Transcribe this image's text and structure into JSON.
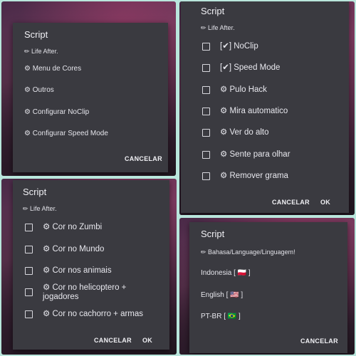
{
  "panel1": {
    "title": "Script",
    "header": "✏ Life After.",
    "items": [
      "⚙ Menu de Cores",
      "⚙ Outros",
      "⚙ Configurar NoClip",
      "⚙ Configurar Speed Mode"
    ],
    "cancel": "CANCELAR"
  },
  "panel2": {
    "title": "Script",
    "header": "✏ Life After.",
    "items": [
      "[✔] NoClip",
      "[✔] Speed Mode",
      "⚙ Pulo Hack",
      "⚙ Mira automatico",
      "⚙ Ver do alto",
      "⚙ Sente para olhar",
      "⚙ Remover grama"
    ],
    "cancel": "CANCELAR",
    "ok": "OK"
  },
  "panel3": {
    "title": "Script",
    "header": "✏ Life After.",
    "items": [
      "⚙ Cor no Zumbi",
      "⚙ Cor no Mundo",
      "⚙ Cor nos animais",
      "⚙ Cor no helicoptero + jogadores",
      "⚙ Cor no cachorro + armas"
    ],
    "cancel": "CANCELAR",
    "ok": "OK"
  },
  "panel4": {
    "title": "Script",
    "header": "✏ Bahasa/Language/Linguagem!",
    "items": [
      "Indonesia [ 🇵🇱 ]",
      "English [ 🇺🇸 ]",
      "PT-BR [ 🇧🇷 ]"
    ],
    "cancel": "CANCELAR"
  },
  "colors": {
    "dialog": "#3a3a40",
    "background": "#b9e6dc",
    "text": "#e8e8ec"
  }
}
